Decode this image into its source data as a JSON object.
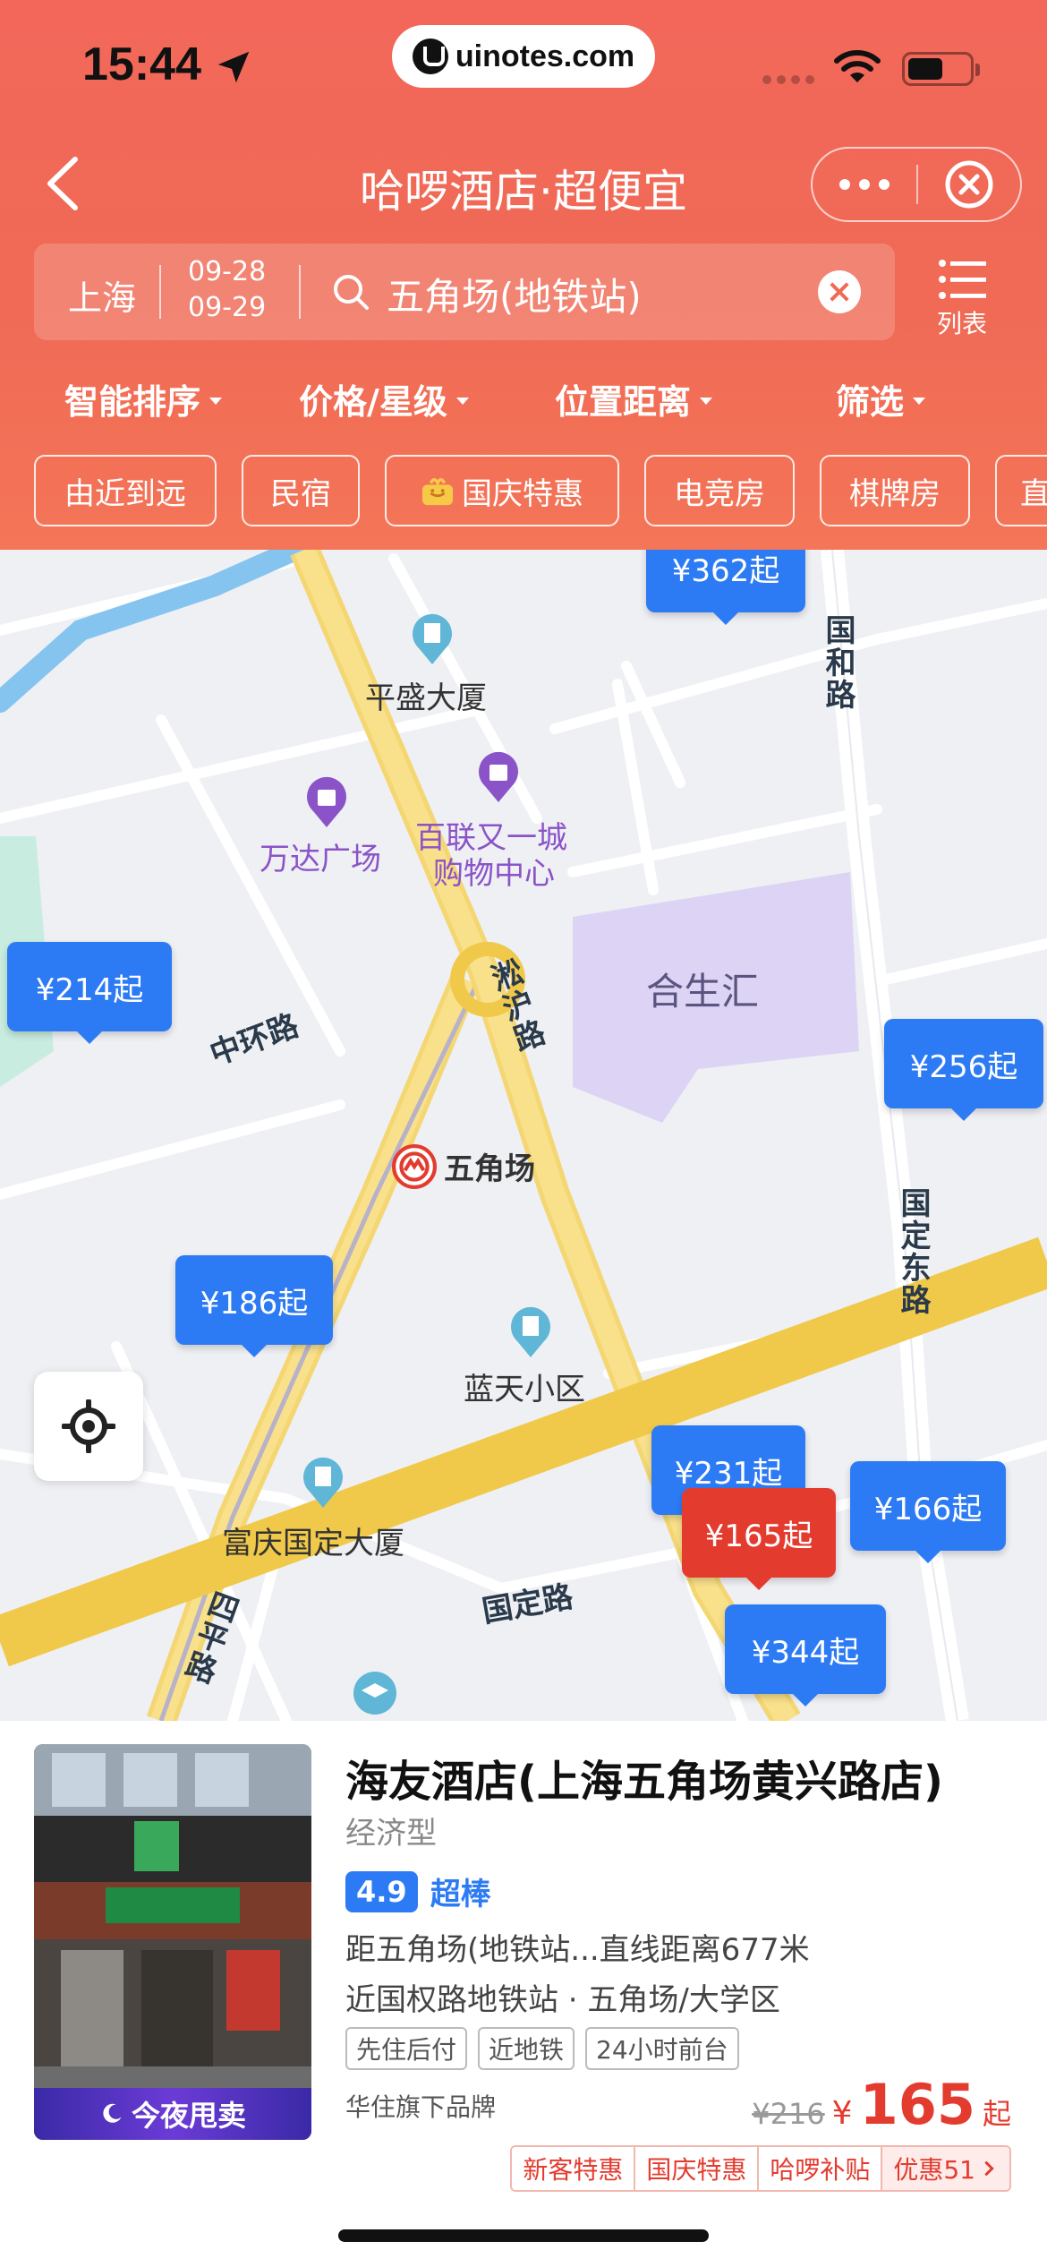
{
  "status_bar": {
    "time": "15:44",
    "url": "uinotes.com"
  },
  "nav": {
    "title": "哈啰酒店·超便宜"
  },
  "search": {
    "city": "上海",
    "checkin": "09-28",
    "checkout": "09-29",
    "query": "五角场(地铁站)",
    "list_label": "列表"
  },
  "sort": [
    "智能排序",
    "价格/星级",
    "位置距离",
    "筛选"
  ],
  "chips": [
    "由近到远",
    "民宿",
    "国庆特惠",
    "电竞房",
    "棋牌房",
    "直"
  ],
  "map": {
    "pois": [
      "平盛大厦",
      "万达广场",
      "百联又一城",
      "购物中心",
      "合生汇",
      "五角场",
      "蓝天小区",
      "富庆国定大厦"
    ],
    "roads": [
      "中环路",
      "淞沪路",
      "国和路",
      "国定东路",
      "国定路",
      "四平路"
    ],
    "markers": [
      {
        "price": "¥362起",
        "active": false
      },
      {
        "price": "¥214起",
        "active": false
      },
      {
        "price": "¥256起",
        "active": false
      },
      {
        "price": "¥186起",
        "active": false
      },
      {
        "price": "¥231起",
        "active": false
      },
      {
        "price": "¥165起",
        "active": true
      },
      {
        "price": "¥166起",
        "active": false
      },
      {
        "price": "¥344起",
        "active": false
      }
    ]
  },
  "hotel": {
    "name": "海友酒店(上海五角场黄兴路店)",
    "type": "经济型",
    "rating": "4.9",
    "rating_text": "超棒",
    "distance": "距五角场(地铁站...直线距离677米",
    "near": "近国权路地铁站 · 五角场/大学区",
    "tags": [
      "先住后付",
      "近地铁",
      "24小时前台"
    ],
    "brand": "华住旗下品牌",
    "badge": "今夜甩卖",
    "old_price": "¥216",
    "currency": "¥",
    "price": "165",
    "price_suffix": "起",
    "promos": [
      "新客特惠",
      "国庆特惠",
      "哈啰补贴",
      "优惠51"
    ]
  },
  "colors": {
    "header": "#f06a55",
    "marker": "#2d7bf4",
    "marker_active": "#e43b2f",
    "price": "#e43b2f"
  }
}
